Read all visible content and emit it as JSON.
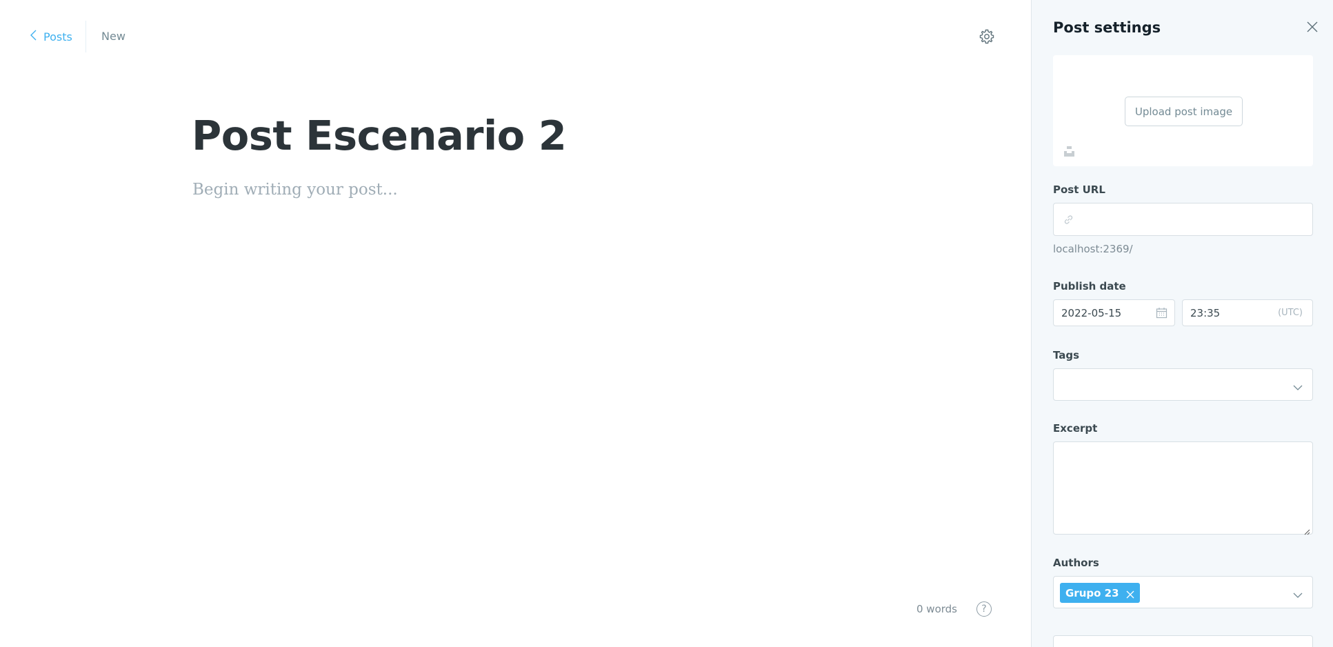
{
  "header": {
    "back_label": "Posts",
    "status": "New"
  },
  "editor": {
    "title": "Post Escenario 2",
    "body_placeholder": "Begin writing your post...",
    "word_count": "0 words",
    "help_label": "?"
  },
  "settings": {
    "title": "Post settings",
    "upload_label": "Upload post image",
    "url_label": "Post URL",
    "url_value": "",
    "url_preview": "localhost:2369/",
    "publish_label": "Publish date",
    "date_value": "2022-05-15",
    "time_value": "23:35",
    "timezone": "(UTC)",
    "tags_label": "Tags",
    "excerpt_label": "Excerpt",
    "excerpt_value": "",
    "authors_label": "Authors",
    "authors": [
      "Grupo 23"
    ]
  },
  "colors": {
    "accent": "#3eb0ef",
    "panel_bg": "#f4f8fb",
    "title": "#2c3439"
  },
  "icons": [
    "chevron-left-icon",
    "gear-icon",
    "close-icon",
    "unsplash-icon",
    "link-icon",
    "calendar-icon",
    "chevron-down-icon",
    "help-icon"
  ]
}
